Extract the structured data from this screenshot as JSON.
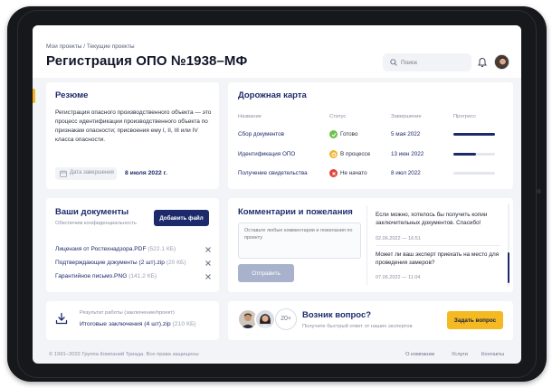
{
  "header": {
    "breadcrumb": "Мои проекты / Текущие проекты",
    "title": "Регистрация ОПО №1938–МФ",
    "search_placeholder": "Поиск"
  },
  "resume": {
    "title": "Резюме",
    "text": "Регистрация опасного производственного объекта — это процесс идентификации производственного объекта по признакам опасности; присвоения ему I, II, III или IV класса опасности.",
    "date_label": "Дата завершения",
    "date_value": "8 июля 2022 г."
  },
  "roadmap": {
    "title": "Дорожная карта",
    "columns": [
      "Название",
      "Статус",
      "Завершение",
      "Прогресс"
    ],
    "rows": [
      {
        "name": "Сбор документов",
        "status": "Готово",
        "status_color": "#6cc24a",
        "date": "5 мая 2022",
        "progress": 1.0
      },
      {
        "name": "Идентификация ОПО",
        "status": "В процессе",
        "status_color": "#f0b429",
        "date": "13 июн 2022",
        "progress": 0.55
      },
      {
        "name": "Получение свидетельства",
        "status": "Не начато",
        "status_color": "#e0443a",
        "date": "8 июл 2022",
        "progress": 0.0
      }
    ]
  },
  "documents": {
    "title": "Ваши документы",
    "subtitle": "Обеспечим конфиденциальность",
    "add_button": "Добавить файл",
    "files": [
      {
        "name": "Лицензия от Ростехнадзора.PDF",
        "size": "(522.1 КБ)"
      },
      {
        "name": "Подтверждающие документы (2 шт).zip",
        "size": "(20 КБ)"
      },
      {
        "name": "Гарантийное письмо.PNG",
        "size": "(141.2 КБ)"
      }
    ]
  },
  "comments": {
    "title": "Комментарии и пожелания",
    "placeholder": "Оставьте любые комментарии и пожелания по проекту",
    "send_button": "Отправить",
    "messages": [
      {
        "text": "Если можно, хотелось бы получить копии заключительных документов. Спасибо!",
        "time": "02.06.2022 — 16:51"
      },
      {
        "text": "Может ли ваш эксперт приехать на место для проведения замеров?",
        "time": "07.06.2022 — 11:04"
      }
    ]
  },
  "result": {
    "label": "Результат работы (заключение/проект)",
    "file": "Итоговые заключения (4 шт).zip",
    "size": "(210 КБ)"
  },
  "question": {
    "count": "20+",
    "title": "Возник вопрос?",
    "subtitle": "Получите быстрый ответ от наших экспертов",
    "button": "Задать вопрос"
  },
  "footer": {
    "copyright": "© 1991–2022 Группа Компаний Триада. Все права защищены",
    "links": [
      "О компании",
      "Услуги",
      "Контакты"
    ]
  },
  "colors": {
    "accent": "#1c2a6b",
    "highlight": "#f5b921"
  }
}
